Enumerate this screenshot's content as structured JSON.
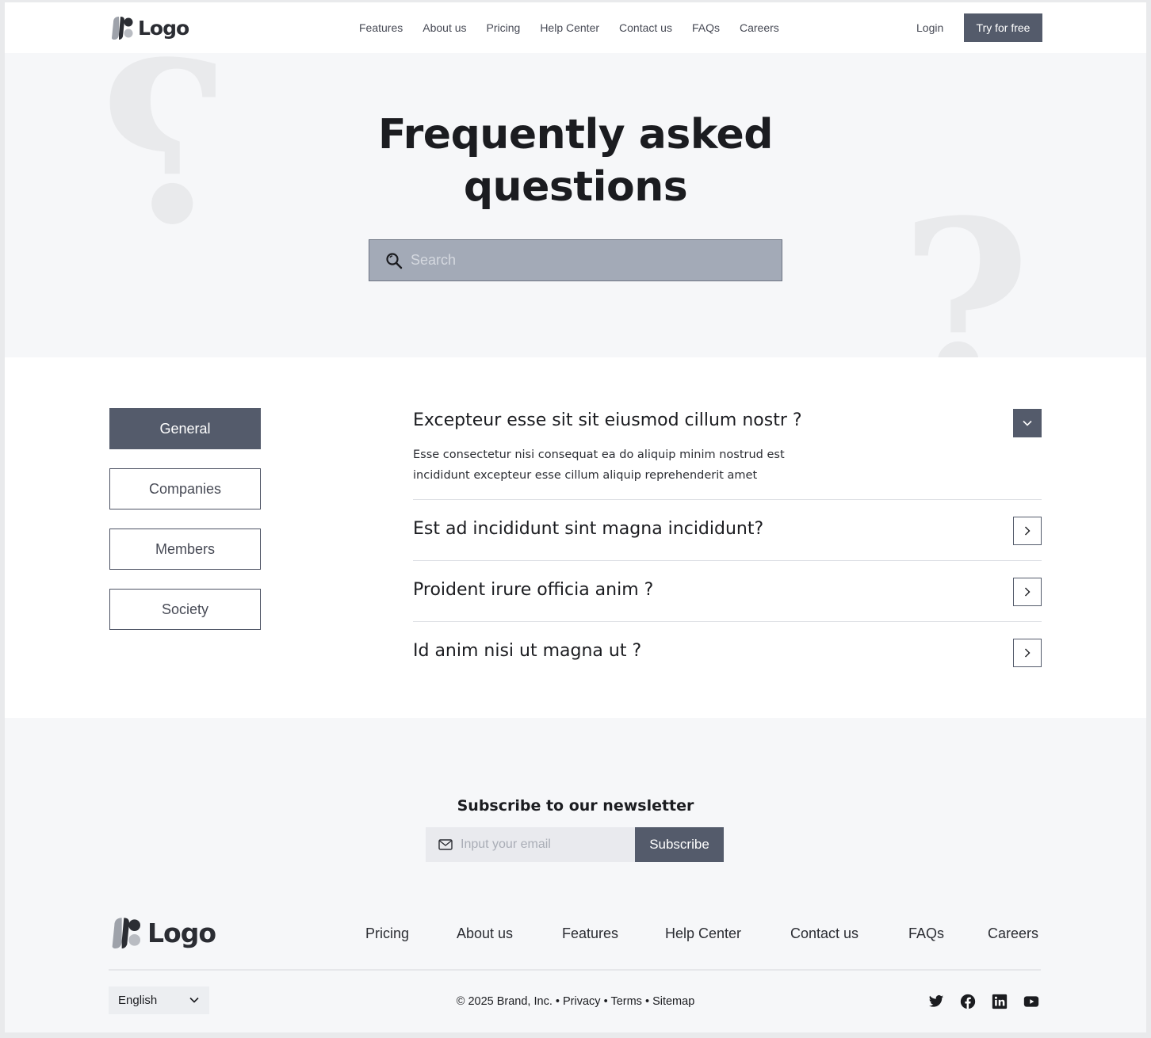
{
  "header": {
    "logo_text": "Logo",
    "nav": [
      "Features",
      "About us",
      "Pricing",
      "Help Center",
      "Contact us",
      "FAQs",
      "Careers"
    ],
    "login": "Login",
    "cta": "Try for free"
  },
  "hero": {
    "title_line1": "Frequently asked",
    "title_line2": "questions",
    "search_placeholder": "Search"
  },
  "categories": [
    {
      "label": "General",
      "active": true
    },
    {
      "label": "Companies",
      "active": false
    },
    {
      "label": "Members",
      "active": false
    },
    {
      "label": "Society",
      "active": false
    }
  ],
  "faqs": [
    {
      "question": "Excepteur esse sit sit eiusmod cillum nostr ?",
      "answer_line1": "Esse consectetur nisi consequat ea do aliquip minim nostrud est",
      "answer_line2": "incididunt excepteur esse cillum aliquip reprehenderit amet",
      "expanded": true
    },
    {
      "question": "Est ad incididunt sint magna incididunt?",
      "expanded": false
    },
    {
      "question": "Proident irure officia anim ?",
      "expanded": false
    },
    {
      "question": "Id anim nisi ut magna ut ?",
      "expanded": false
    }
  ],
  "newsletter": {
    "title": "Subscribe to our newsletter",
    "email_placeholder": "Input your email",
    "button": "Subscribe"
  },
  "footer": {
    "logo_text": "Logo",
    "nav": [
      "Pricing",
      "About us",
      "Features",
      "Help Center",
      "Contact us",
      "FAQs",
      "Careers"
    ],
    "language": "English",
    "copyright": "© 2025 Brand, Inc.",
    "sep": "•",
    "privacy": "Privacy",
    "terms": "Terms",
    "sitemap": "Sitemap",
    "social_icons": [
      "twitter-icon",
      "facebook-icon",
      "linkedin-icon",
      "youtube-icon"
    ]
  },
  "colors": {
    "accent": "#545b6b",
    "hero_bg": "#f6f7f9",
    "search_bg": "#a3aab7"
  }
}
